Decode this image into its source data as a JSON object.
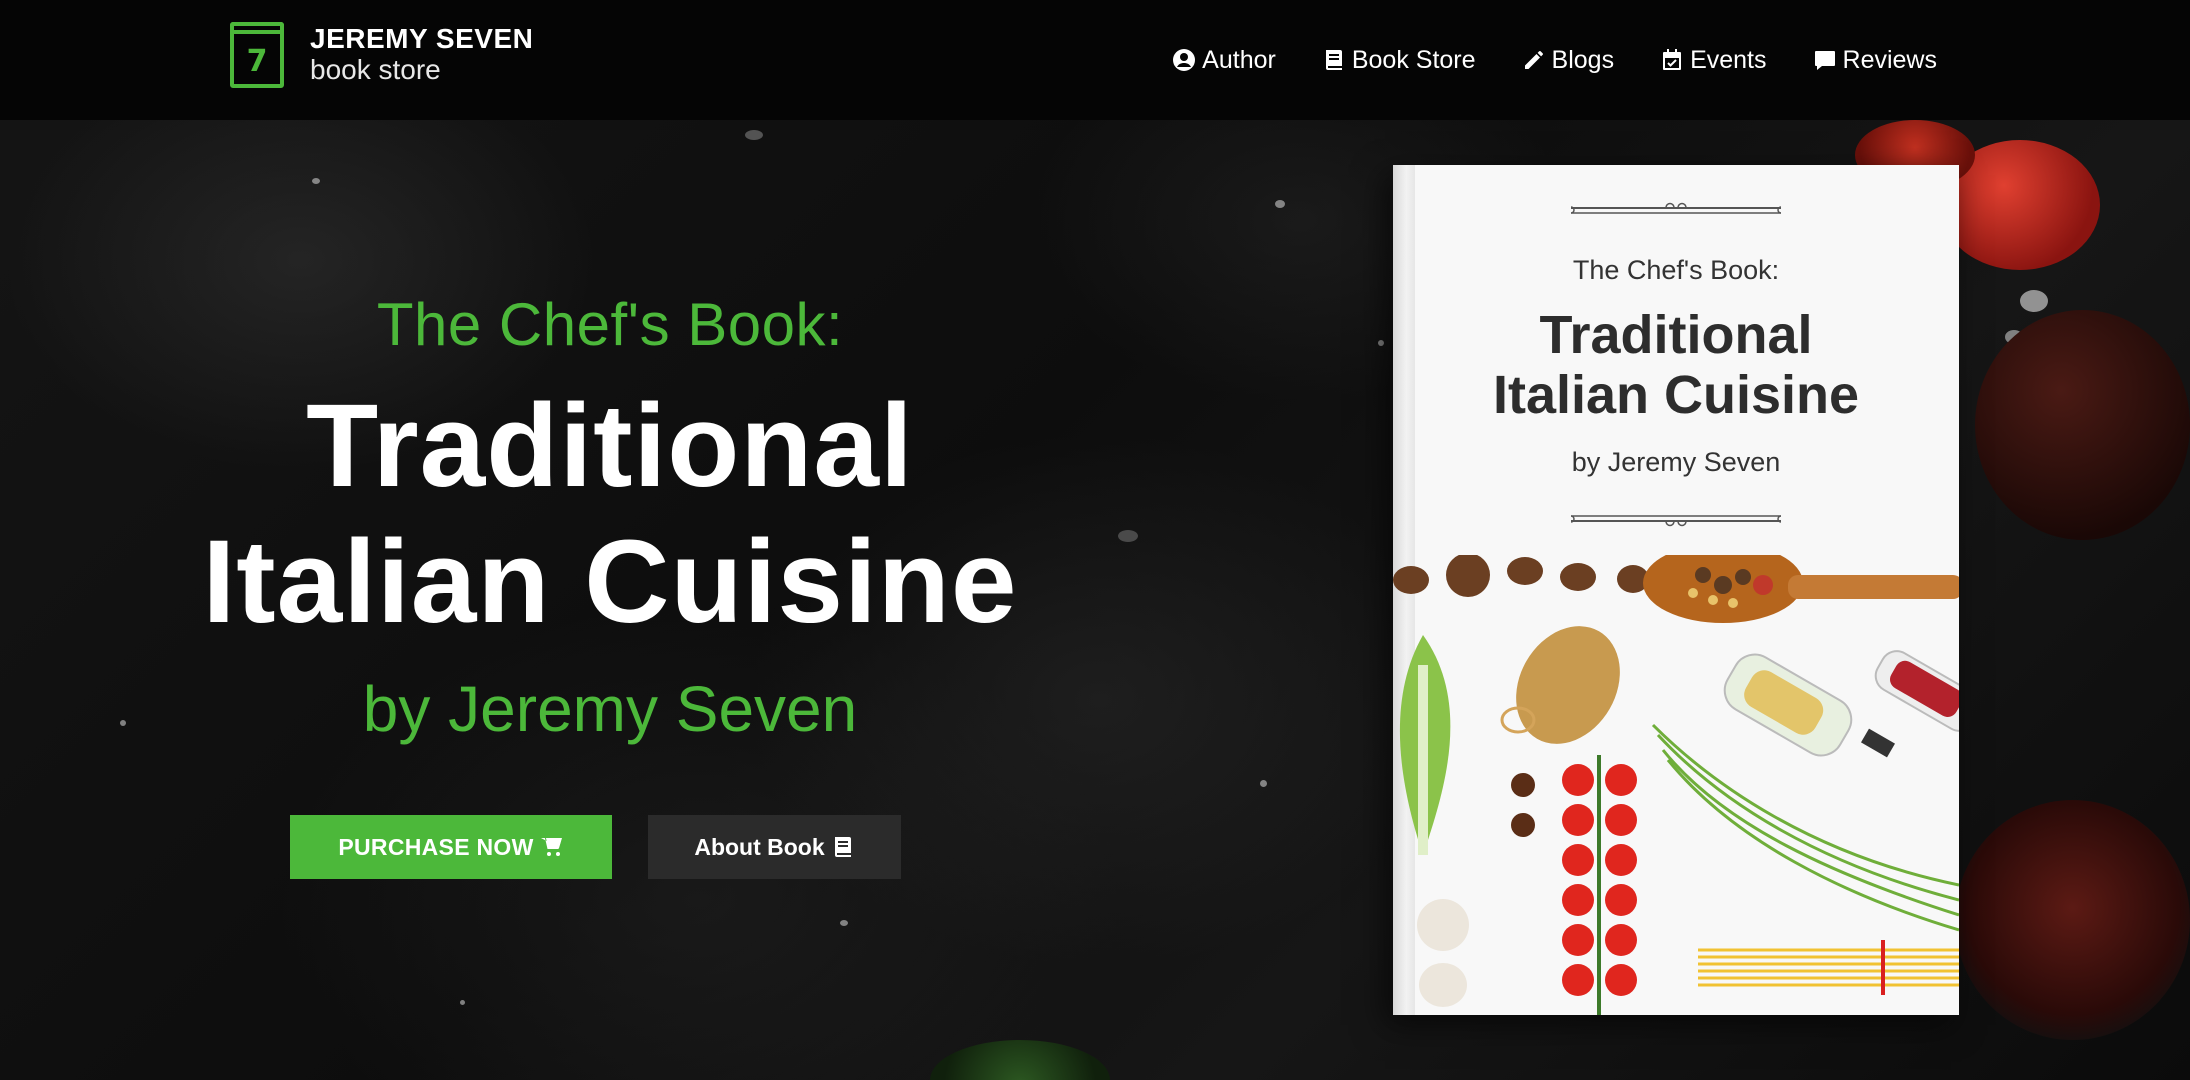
{
  "brand": {
    "logo_number": "7",
    "name": "JEREMY SEVEN",
    "subtitle": "book store"
  },
  "nav": {
    "items": [
      {
        "label": "Author",
        "icon": "user-circle-icon"
      },
      {
        "label": "Book Store",
        "icon": "book-icon"
      },
      {
        "label": "Blogs",
        "icon": "pencil-icon"
      },
      {
        "label": "Events",
        "icon": "calendar-check-icon"
      },
      {
        "label": "Reviews",
        "icon": "comment-icon"
      }
    ]
  },
  "hero": {
    "pre_title": "The Chef's Book:",
    "title_line1": "Traditional",
    "title_line2": "Italian Cuisine",
    "byline": "by Jeremy Seven",
    "purchase_label": "PURCHASE NOW",
    "purchase_icon": "cart-icon",
    "about_label": "About Book",
    "about_icon": "book-icon"
  },
  "book_cover": {
    "pre_title": "The Chef's Book:",
    "title_line1": "Traditional",
    "title_line2": "Italian Cuisine",
    "byline": "by Jeremy Seven"
  },
  "colors": {
    "accent": "#4cb83a",
    "navbar_bg": "#050505",
    "about_button_bg": "#2b2b2b"
  }
}
